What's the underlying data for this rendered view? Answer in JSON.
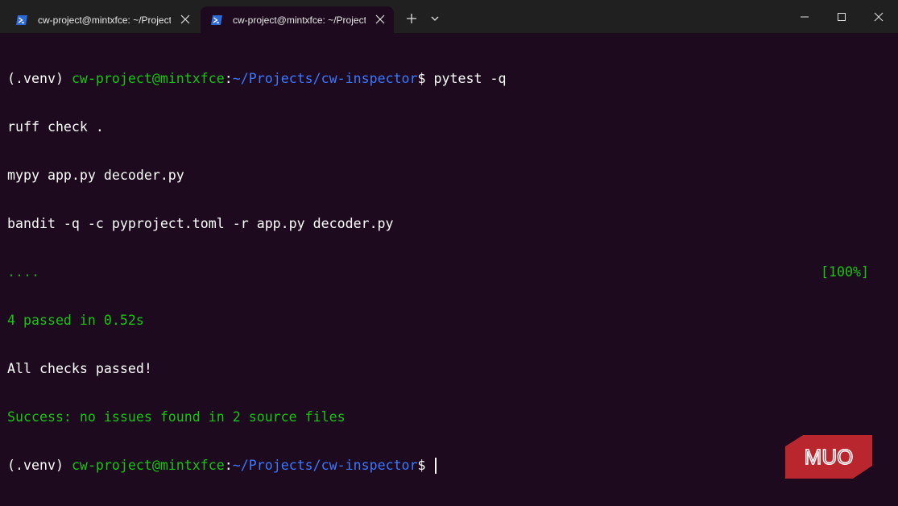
{
  "window": {
    "tabs": [
      {
        "title": "cw-project@mintxfce: ~/Projects/cw-inspector",
        "icon": "powershell-icon",
        "active": false
      },
      {
        "title": "cw-project@mintxfce: ~/Projects/cw-inspector",
        "icon": "powershell-icon",
        "active": true
      }
    ],
    "new_tab_icon": "plus-icon",
    "dropdown_icon": "chevron-down-icon",
    "controls": [
      "minimize-icon",
      "maximize-icon",
      "close-icon"
    ]
  },
  "terminal": {
    "prompt_venv": "(.venv) ",
    "prompt_user": "cw-project@mintxfce",
    "prompt_colon": ":",
    "prompt_path": "~/Projects/cw-inspector",
    "prompt_dollar": "$ ",
    "command": "pytest -q",
    "lines": [
      "ruff check .",
      "mypy app.py decoder.py",
      "bandit -q -c pyproject.toml -r app.py decoder.py"
    ],
    "progress_dots": "....",
    "progress_percent": "[100%]",
    "pytest_result": "4 passed in 0.52s",
    "all_checks": "All checks passed!",
    "mypy_result": "Success: no issues found in 2 source files"
  },
  "watermark": {
    "text": "MUO"
  },
  "colors": {
    "background": "#1e0a1e",
    "titlebar": "#202020",
    "green": "#16c60c",
    "blue": "#3b78ff",
    "watermark": "#b9262d"
  }
}
